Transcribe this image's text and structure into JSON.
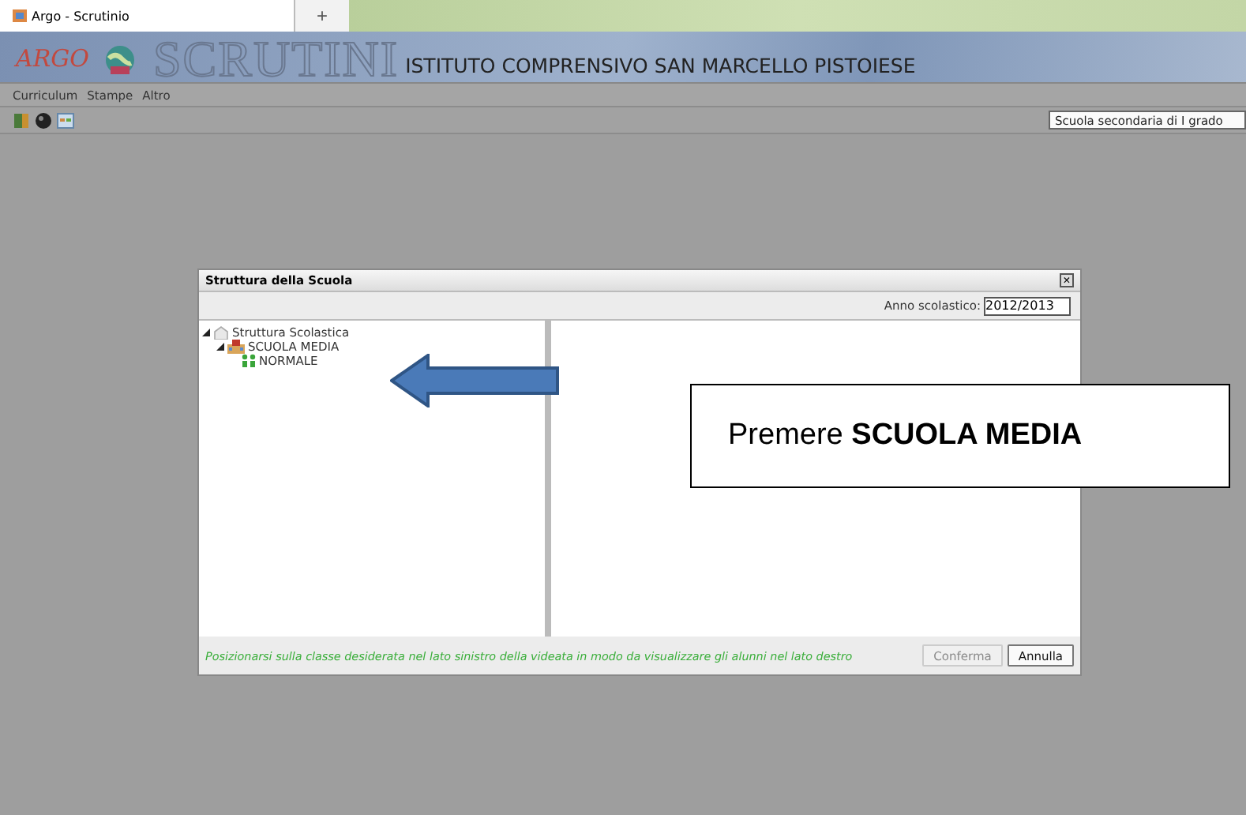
{
  "browser": {
    "tab_title": "Argo - Scrutinio",
    "new_tab": "+"
  },
  "header": {
    "logo": "ARGO",
    "app_name": "SCRUTINI",
    "school": "ISTITUTO COMPRENSIVO SAN MARCELLO PISTOIESE"
  },
  "menu": [
    "Curriculum",
    "Stampe",
    "Altro"
  ],
  "school_type": {
    "value": "Scuola secondaria di I grado"
  },
  "dialog": {
    "title": "Struttura della Scuola",
    "close": "×",
    "year_label": "Anno scolastico:",
    "year_value": "2012/2013",
    "tree": [
      {
        "label": "Struttura Scolastica",
        "expanded": true,
        "children": [
          {
            "label": "SCUOLA MEDIA",
            "expanded": true,
            "children": [
              {
                "label": "NORMALE"
              }
            ]
          }
        ]
      }
    ],
    "hint": "Posizionarsi sulla classe desiderata nel lato sinistro della videata in modo da visualizzare gli alunni nel lato destro",
    "buttons": [
      {
        "label": "Conferma",
        "disabled": true
      },
      {
        "label": "Annulla",
        "disabled": false
      }
    ]
  },
  "callout": {
    "text": "Premere **SCUOLA MEDIA**"
  }
}
